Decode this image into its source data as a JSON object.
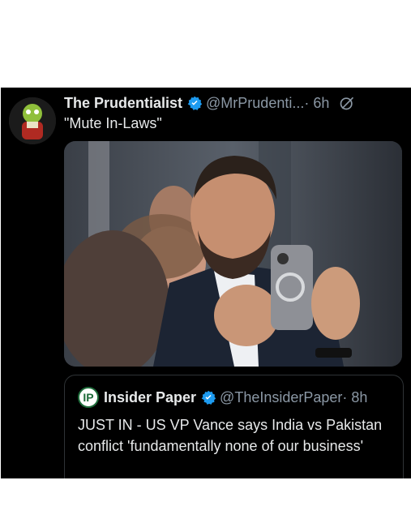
{
  "post": {
    "author_name": "The Prudentialist",
    "handle": "@MrPrudenti...",
    "time": "· 6h",
    "text": "\"Mute In-Laws\""
  },
  "quoted": {
    "logo_text": "IP",
    "author_name": "Insider Paper",
    "handle": "@TheInsiderPaper",
    "time": "· 8h",
    "text": "JUST IN - US VP Vance says India vs Pakistan conflict 'fundamentally none of our business'"
  },
  "colors": {
    "background": "#000000",
    "verified": "#1d9bf0",
    "text": "#e7e9ea",
    "muted": "#8b98a5"
  },
  "icons": [
    "verified-badge-icon",
    "grok-icon"
  ]
}
